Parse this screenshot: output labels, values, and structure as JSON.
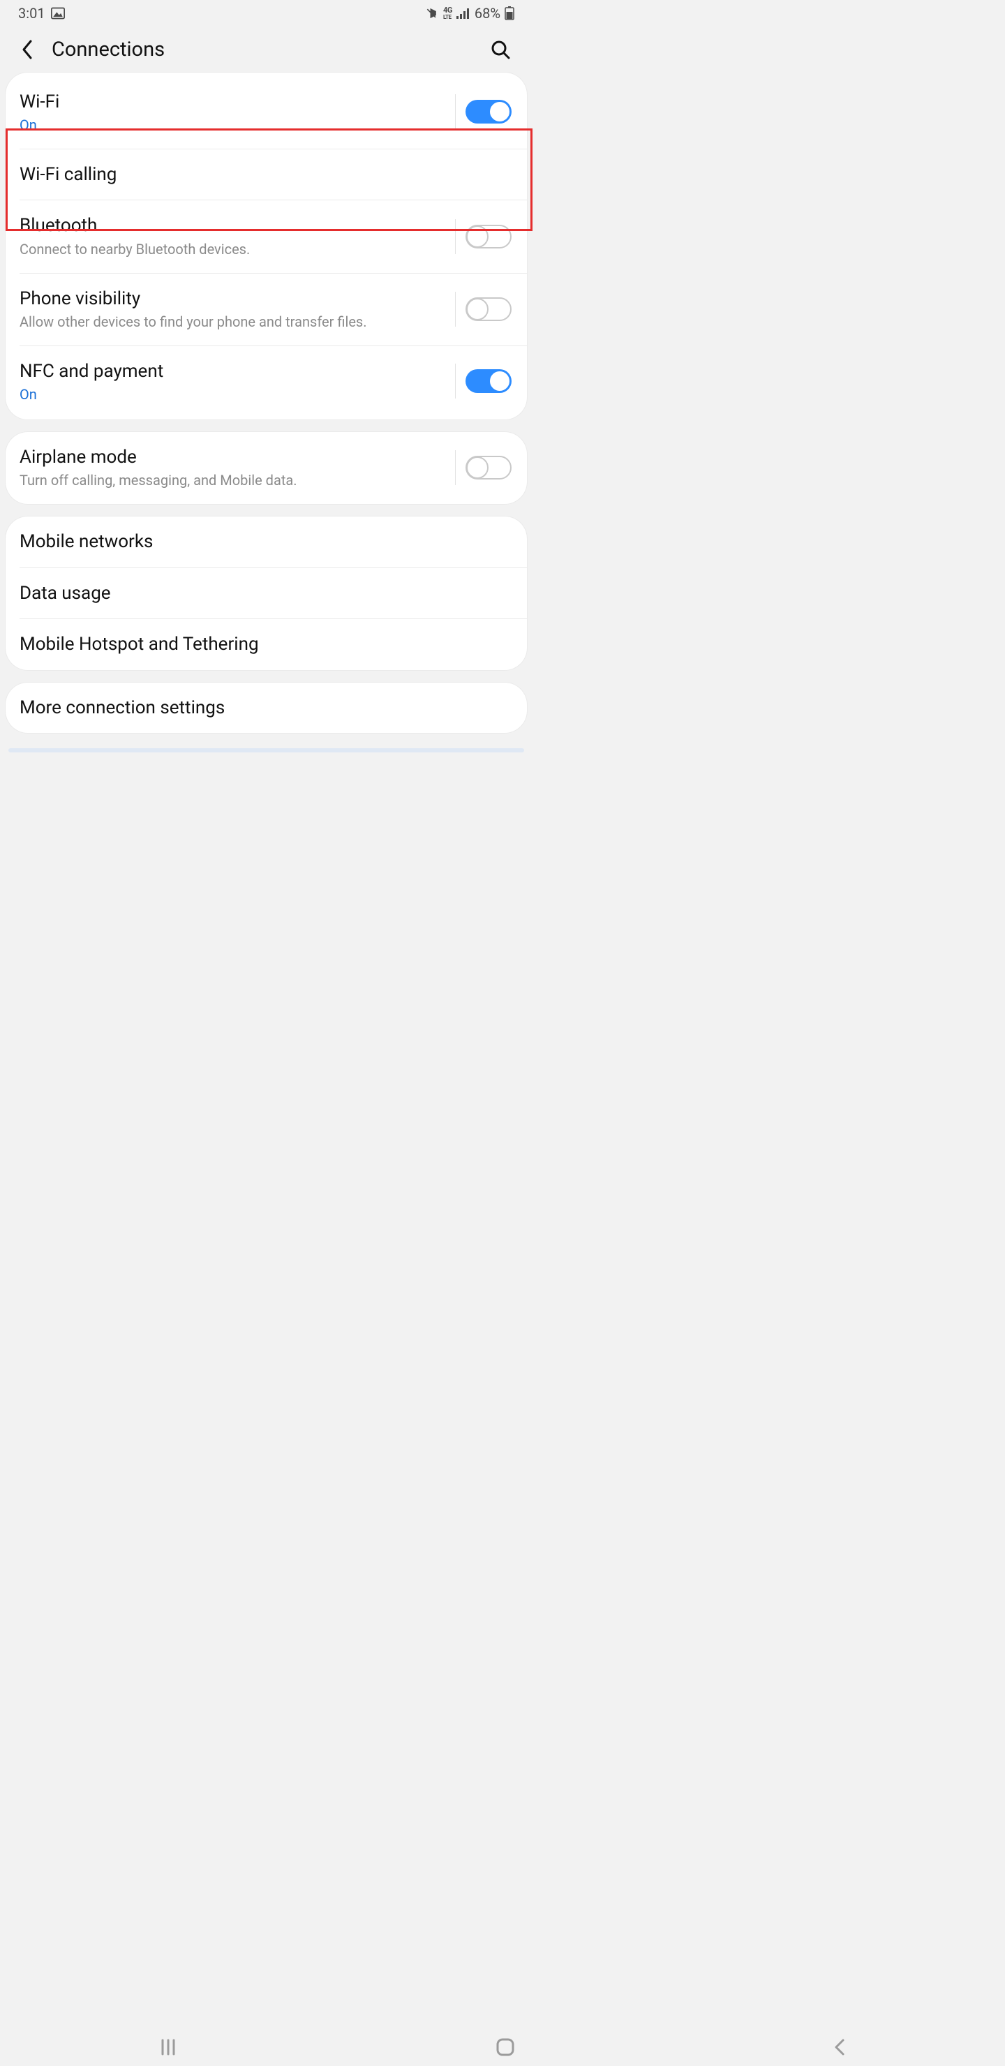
{
  "status": {
    "time": "3:01",
    "battery_pct": "68%",
    "network_label": "4G LTE"
  },
  "header": {
    "title": "Connections"
  },
  "groups": [
    {
      "items": [
        {
          "title": "Wi-Fi",
          "sub_blue": "On",
          "switch": true,
          "highlighted": true
        },
        {
          "title": "Wi-Fi calling"
        },
        {
          "title": "Bluetooth",
          "sub_grey": "Connect to nearby Bluetooth devices.",
          "switch": false
        },
        {
          "title": "Phone visibility",
          "sub_grey": "Allow other devices to find your phone and transfer files.",
          "switch": false
        },
        {
          "title": "NFC and payment",
          "sub_blue": "On",
          "switch": true
        }
      ]
    },
    {
      "items": [
        {
          "title": "Airplane mode",
          "sub_grey": "Turn off calling, messaging, and Mobile data.",
          "switch": false
        }
      ]
    },
    {
      "items": [
        {
          "title": "Mobile networks"
        },
        {
          "title": "Data usage"
        },
        {
          "title": "Mobile Hotspot and Tethering"
        }
      ]
    },
    {
      "items": [
        {
          "title": "More connection settings"
        }
      ]
    }
  ],
  "colors": {
    "accent": "#2d8cff",
    "link_blue": "#1a6fd6",
    "highlight_red": "#e52d2d"
  }
}
